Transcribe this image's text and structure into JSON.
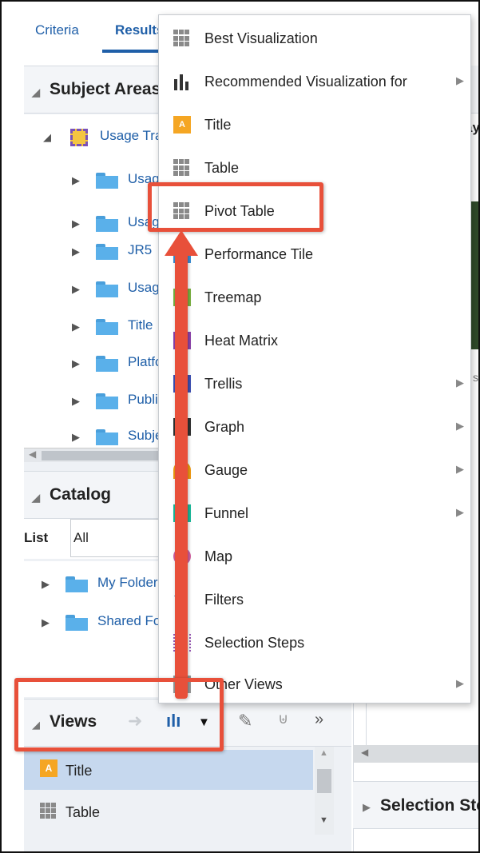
{
  "tabs": [
    {
      "label": "Criteria"
    },
    {
      "label": "Results"
    }
  ],
  "subject_area": {
    "header": "Subject Areas",
    "root": "Usage Tracking",
    "children": [
      "Usage",
      "Usage",
      "JR5",
      "Usage",
      "Title",
      "Platform",
      "Publisher",
      "Subject"
    ]
  },
  "catalog": {
    "header": "Catalog",
    "list_label": "List",
    "list_value": "All",
    "folders": [
      "My Folders",
      "Shared Folders"
    ]
  },
  "views": {
    "header": "Views",
    "items": [
      {
        "label": "Title",
        "selected": true
      },
      {
        "label": "Table",
        "selected": false
      }
    ]
  },
  "right": {
    "selection_header": "Selection Steps",
    "top_col_fragment": "ay",
    "side_fragment": "s"
  },
  "menu": {
    "items": [
      {
        "label": "Best Visualization",
        "icon": "grid-icon",
        "submenu": false
      },
      {
        "label": "Recommended Visualization for",
        "icon": "bar-chart-icon",
        "submenu": true
      },
      {
        "label": "Title",
        "icon": "title-icon",
        "submenu": false
      },
      {
        "label": "Table",
        "icon": "table-icon",
        "submenu": false
      },
      {
        "label": "Pivot Table",
        "icon": "pivot-table-icon",
        "submenu": false
      },
      {
        "label": "Performance Tile",
        "icon": "performance-tile-icon",
        "submenu": false
      },
      {
        "label": "Treemap",
        "icon": "treemap-icon",
        "submenu": false
      },
      {
        "label": "Heat Matrix",
        "icon": "heat-matrix-icon",
        "submenu": false
      },
      {
        "label": "Trellis",
        "icon": "trellis-icon",
        "submenu": true
      },
      {
        "label": "Graph",
        "icon": "graph-icon",
        "submenu": true
      },
      {
        "label": "Gauge",
        "icon": "gauge-icon",
        "submenu": true
      },
      {
        "label": "Funnel",
        "icon": "funnel-icon",
        "submenu": true
      },
      {
        "label": "Map",
        "icon": "map-icon",
        "submenu": false
      },
      {
        "label": "Filters",
        "icon": "filters-icon",
        "submenu": false
      },
      {
        "label": "Selection Steps",
        "icon": "selection-steps-icon",
        "submenu": false
      },
      {
        "label": "Other Views",
        "icon": "other-views-icon",
        "submenu": true
      }
    ]
  },
  "colors": {
    "accent": "#1f5fa8",
    "annotation": "#e8503a",
    "selected_row": "#c6d8ee"
  }
}
